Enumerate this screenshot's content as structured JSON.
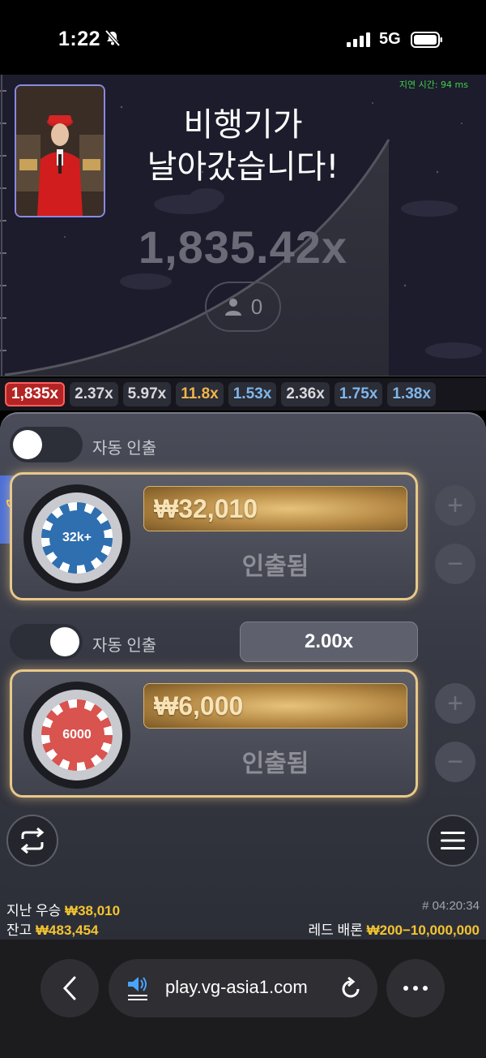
{
  "status_bar": {
    "time": "1:22",
    "network": "5G",
    "icons": [
      "bell-muted-icon",
      "signal-icon",
      "battery-icon"
    ]
  },
  "game": {
    "latency": "지연 시간: 94 ms",
    "title_line1": "비행기가",
    "title_line2": "날아갔습니다!",
    "multiplier": "1,835.42x",
    "players": "0"
  },
  "history": [
    "1,835x",
    "2.37x",
    "5.97x",
    "11.8x",
    "1.53x",
    "2.36x",
    "1.75x",
    "1.38x"
  ],
  "history_colors": [
    "#ffffff",
    "#d8d8dc",
    "#d8d8dc",
    "#f0b44a",
    "#7fb6ea",
    "#d8d8dc",
    "#7fb6ea",
    "#7fb6ea"
  ],
  "bet1": {
    "auto_cashout_label": "자동 인출",
    "auto_cashout_on": false,
    "chip_label": "32k+",
    "amount": "₩32,010",
    "status": "인출됨"
  },
  "bet2": {
    "auto_cashout_label": "자동 인출",
    "auto_cashout_on": true,
    "auto_value": "2.00x",
    "chip_label": "6000",
    "amount": "₩6,000",
    "status": "인출됨"
  },
  "stepper": {
    "plus": "+",
    "minus": "−"
  },
  "footer": {
    "last_win_label": "지난 우승",
    "last_win_value": "₩38,010",
    "balance_label": "잔고",
    "balance_value": "₩483,454",
    "round_id": "# 04:20:34",
    "range_label": "레드 배론",
    "range_value": "₩200−10,000,000"
  },
  "browser": {
    "url": "play.vg-asia1.com"
  },
  "colors": {
    "accent_gold": "#f4c430",
    "card_border": "#e8c88a",
    "chip_blue": "#2f6fb0",
    "chip_red": "#d9534f"
  }
}
